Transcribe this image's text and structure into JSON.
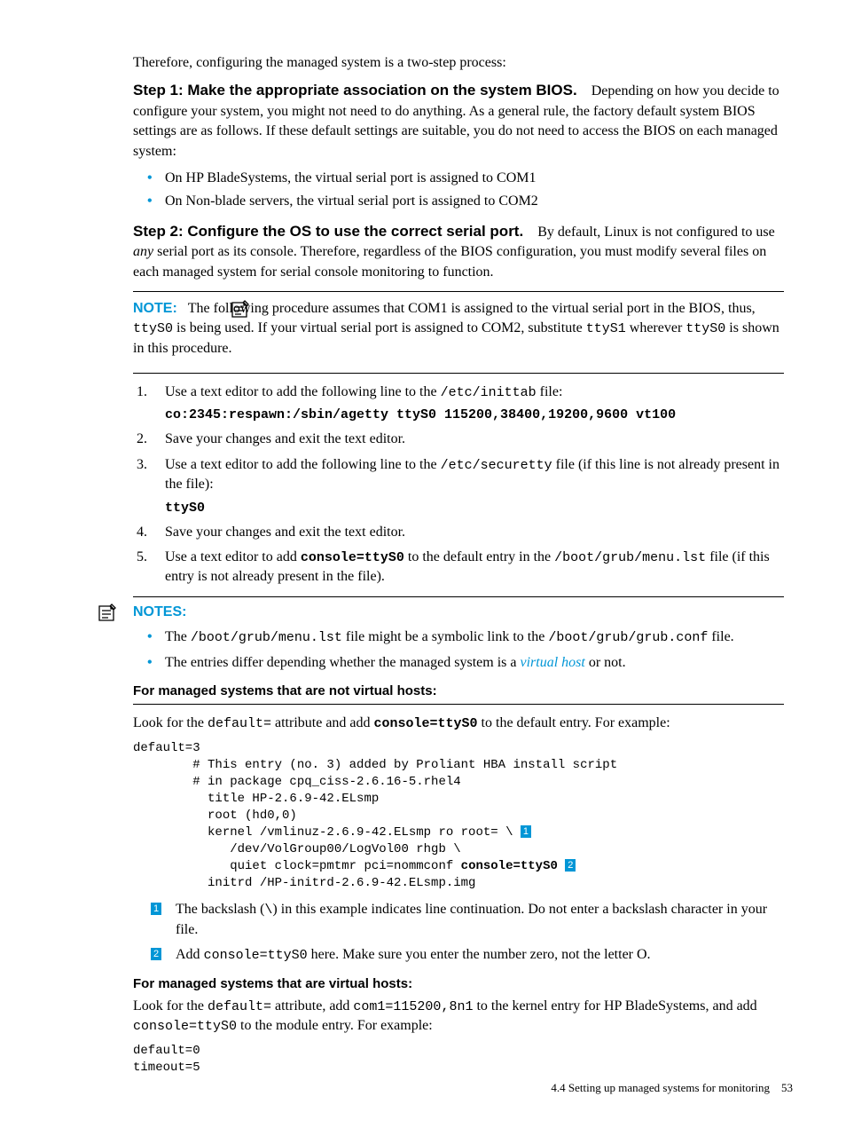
{
  "intro": "Therefore, configuring the managed system is a two-step process:",
  "step1": {
    "title": "Step 1: Make the appropriate association on the system BIOS.",
    "body": "Depending on how you decide to configure your system, you might not need to do anything. As a general rule, the factory default system BIOS settings are as follows. If these default settings are suitable, you do not need to access the BIOS on each managed system:",
    "bullets": [
      "On HP BladeSystems, the virtual serial port is assigned to COM1",
      "On Non-blade servers, the virtual serial port is assigned to COM2"
    ]
  },
  "step2": {
    "title": "Step 2: Configure the OS to use the correct serial port.",
    "body_prefix": "By default, Linux is not configured to use ",
    "body_italic": "any",
    "body_suffix": " serial port as its console. Therefore, regardless of the BIOS configuration, you must modify several files on each managed system for serial console monitoring to function."
  },
  "note1": {
    "label": "NOTE:",
    "text_prefix": "The following procedure assumes that COM1 is assigned to the virtual serial port in the BIOS, thus, ",
    "tty0a": "ttyS0",
    "text_mid": " is being used. If your virtual serial port is assigned to COM2, substitute ",
    "tty1": "ttyS1",
    "text_mid2": " wherever ",
    "tty0b": "ttyS0",
    "text_suffix": " is shown in this procedure."
  },
  "steps": {
    "s1_prefix": "Use a text editor to add the following line to the ",
    "s1_mono": "/etc/inittab",
    "s1_suffix": " file:",
    "s1_code": "co:2345:respawn:/sbin/agetty ttyS0 115200,38400,19200,9600 vt100",
    "s2": "Save your changes and exit the text editor.",
    "s3_prefix": "Use a text editor to add the following line to the ",
    "s3_mono": "/etc/securetty",
    "s3_suffix": " file (if this line is not already present in the file):",
    "s3_code": "ttyS0",
    "s4": "Save your changes and exit the text editor.",
    "s5_prefix": "Use a text editor to add ",
    "s5_bold": "console=ttyS0",
    "s5_mid": " to the default entry in the ",
    "s5_mono": "/boot/grub/menu.lst",
    "s5_suffix": " file (if this entry is not already present in the file)."
  },
  "note2": {
    "label": "NOTES:",
    "b1_prefix": "The ",
    "b1_mono1": "/boot/grub/menu.lst",
    "b1_mid": " file might be a symbolic link to the ",
    "b1_mono2": "/boot/grub/grub.conf",
    "b1_suffix": " file.",
    "b2_prefix": "The entries differ depending whether the managed system is a ",
    "b2_italic": "virtual host",
    "b2_suffix": " or not."
  },
  "nonvh": {
    "heading": "For managed systems that are not virtual hosts:",
    "lead_prefix": "Look for the ",
    "lead_mono": "default=",
    "lead_mid": " attribute and add ",
    "lead_bold": "console=ttyS0",
    "lead_suffix": " to the default entry. For example:",
    "code_l1": "default=3",
    "code_l2": "        # This entry (no. 3) added by Proliant HBA install script",
    "code_l3": "        # in package cpq_ciss-2.6.16-5.rhel4",
    "code_l4": "          title HP-2.6.9-42.ELsmp",
    "code_l5": "          root (hd0,0)",
    "code_l6": "          kernel /vmlinuz-2.6.9-42.ELsmp ro root= \\ ",
    "code_l7": "             /dev/VolGroup00/LogVol00 rhgb \\",
    "code_l8a": "             quiet clock=pmtmr pci=nommconf ",
    "code_l8b": "console=ttyS0",
    "code_l9": "          initrd /HP-initrd-2.6.9-42.ELsmp.img",
    "c1_prefix": "The backslash (",
    "c1_mono": "\\",
    "c1_suffix": ") in this example indicates line continuation. Do not enter a backslash character in your file.",
    "c2_prefix": "Add ",
    "c2_mono": "console=ttyS0",
    "c2_suffix": " here. Make sure you enter the number zero, not the letter O."
  },
  "vh": {
    "heading": "For managed systems that are virtual hosts:",
    "lead_prefix": "Look for the ",
    "lead_mono1": "default=",
    "lead_mid1": " attribute, add ",
    "lead_mono2": "com1=115200,8n1",
    "lead_mid2": " to the kernel entry for HP BladeSystems, and add ",
    "lead_mono3": "console=ttyS0",
    "lead_suffix": " to the module entry. For example:",
    "code_l1": "default=0",
    "code_l2": "timeout=5"
  },
  "footer": {
    "section": "4.4 Setting up managed systems for monitoring",
    "page": "53"
  },
  "callout_labels": {
    "one": "1",
    "two": "2"
  }
}
